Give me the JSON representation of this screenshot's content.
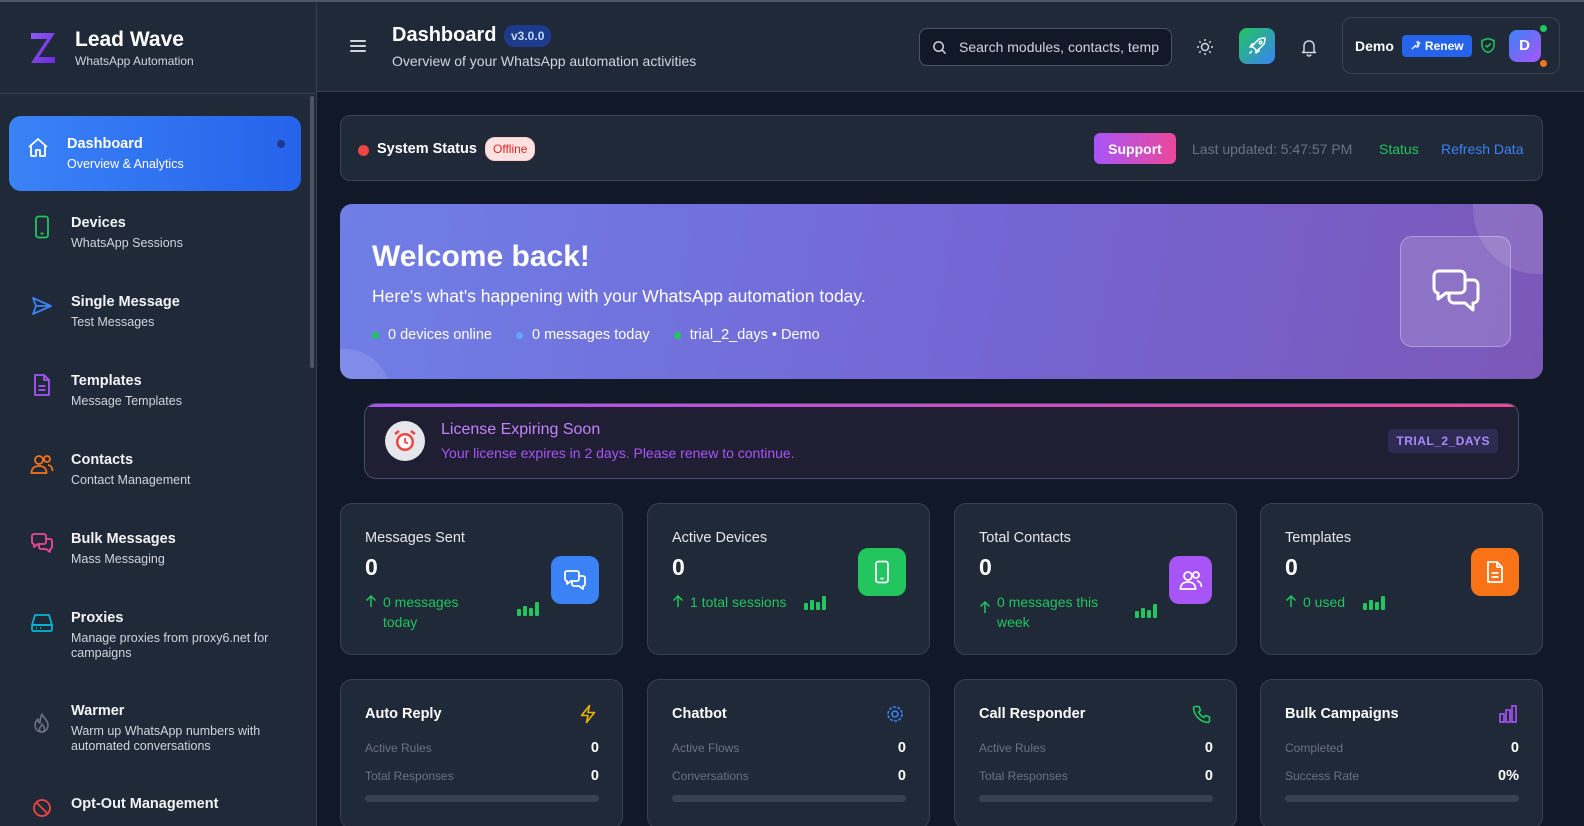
{
  "brand": {
    "title": "Lead Wave",
    "subtitle": "WhatsApp Automation"
  },
  "sidebar": {
    "items": [
      {
        "label": "Dashboard",
        "sub": "Overview & Analytics",
        "icon": "home-icon",
        "active": true
      },
      {
        "label": "Devices",
        "sub": "WhatsApp Sessions",
        "icon": "phone-icon"
      },
      {
        "label": "Single Message",
        "sub": "Test Messages",
        "icon": "send-icon"
      },
      {
        "label": "Templates",
        "sub": "Message Templates",
        "icon": "file-icon"
      },
      {
        "label": "Contacts",
        "sub": "Contact Management",
        "icon": "users-icon"
      },
      {
        "label": "Bulk Messages",
        "sub": "Mass Messaging",
        "icon": "chat-icon"
      },
      {
        "label": "Proxies",
        "sub": "Manage proxies from proxy6.net for campaigns",
        "icon": "server-icon"
      },
      {
        "label": "Warmer",
        "sub": "Warm up WhatsApp numbers with automated conversations",
        "icon": "flame-icon"
      },
      {
        "label": "Opt-Out Management",
        "sub": "",
        "icon": "block-icon"
      }
    ]
  },
  "header": {
    "title": "Dashboard",
    "version": "v3.0.0",
    "subtitle": "Overview of your WhatsApp automation activities",
    "search_placeholder": "Search modules, contacts, templates...",
    "user": "Demo",
    "renew": "Renew",
    "avatar": "D"
  },
  "status": {
    "title": "System Status",
    "badge": "Offline",
    "support": "Support",
    "updated": "Last updated: 5:47:57 PM",
    "status_link": "Status",
    "refresh_link": "Refresh Data"
  },
  "welcome": {
    "title": "Welcome back!",
    "subtitle": "Here's what's happening with your WhatsApp automation today.",
    "stats": [
      {
        "text": "0 devices online",
        "color": "#22c55e"
      },
      {
        "text": "0 messages today",
        "color": "#60a5fa"
      },
      {
        "text": "trial_2_days • Demo",
        "color": "#22c55e"
      }
    ]
  },
  "license": {
    "title": "License Expiring Soon",
    "subtitle": "Your license expires in 2 days. Please renew to continue.",
    "badge": "TRIAL_2_DAYS"
  },
  "stats": [
    {
      "label": "Messages Sent",
      "value": "0",
      "trend": "0 messages today",
      "color": "#3b82f6"
    },
    {
      "label": "Active Devices",
      "value": "0",
      "trend": "1 total sessions",
      "color": "#22c55e"
    },
    {
      "label": "Total Contacts",
      "value": "0",
      "trend": "0 messages this week",
      "color": "#a855f7"
    },
    {
      "label": "Templates",
      "value": "0",
      "trend": "0 used",
      "color": "#f97316"
    }
  ],
  "modules": [
    {
      "title": "Auto Reply",
      "icon_color": "#eab308",
      "rows": [
        {
          "k": "Active Rules",
          "v": "0"
        },
        {
          "k": "Total Responses",
          "v": "0"
        }
      ]
    },
    {
      "title": "Chatbot",
      "icon_color": "#3b82f6",
      "rows": [
        {
          "k": "Active Flows",
          "v": "0"
        },
        {
          "k": "Conversations",
          "v": "0"
        }
      ]
    },
    {
      "title": "Call Responder",
      "icon_color": "#22c55e",
      "rows": [
        {
          "k": "Active Rules",
          "v": "0"
        },
        {
          "k": "Total Responses",
          "v": "0"
        }
      ]
    },
    {
      "title": "Bulk Campaigns",
      "icon_color": "#a855f7",
      "rows": [
        {
          "k": "Completed",
          "v": "0"
        },
        {
          "k": "Success Rate",
          "v": "0%"
        }
      ]
    }
  ]
}
